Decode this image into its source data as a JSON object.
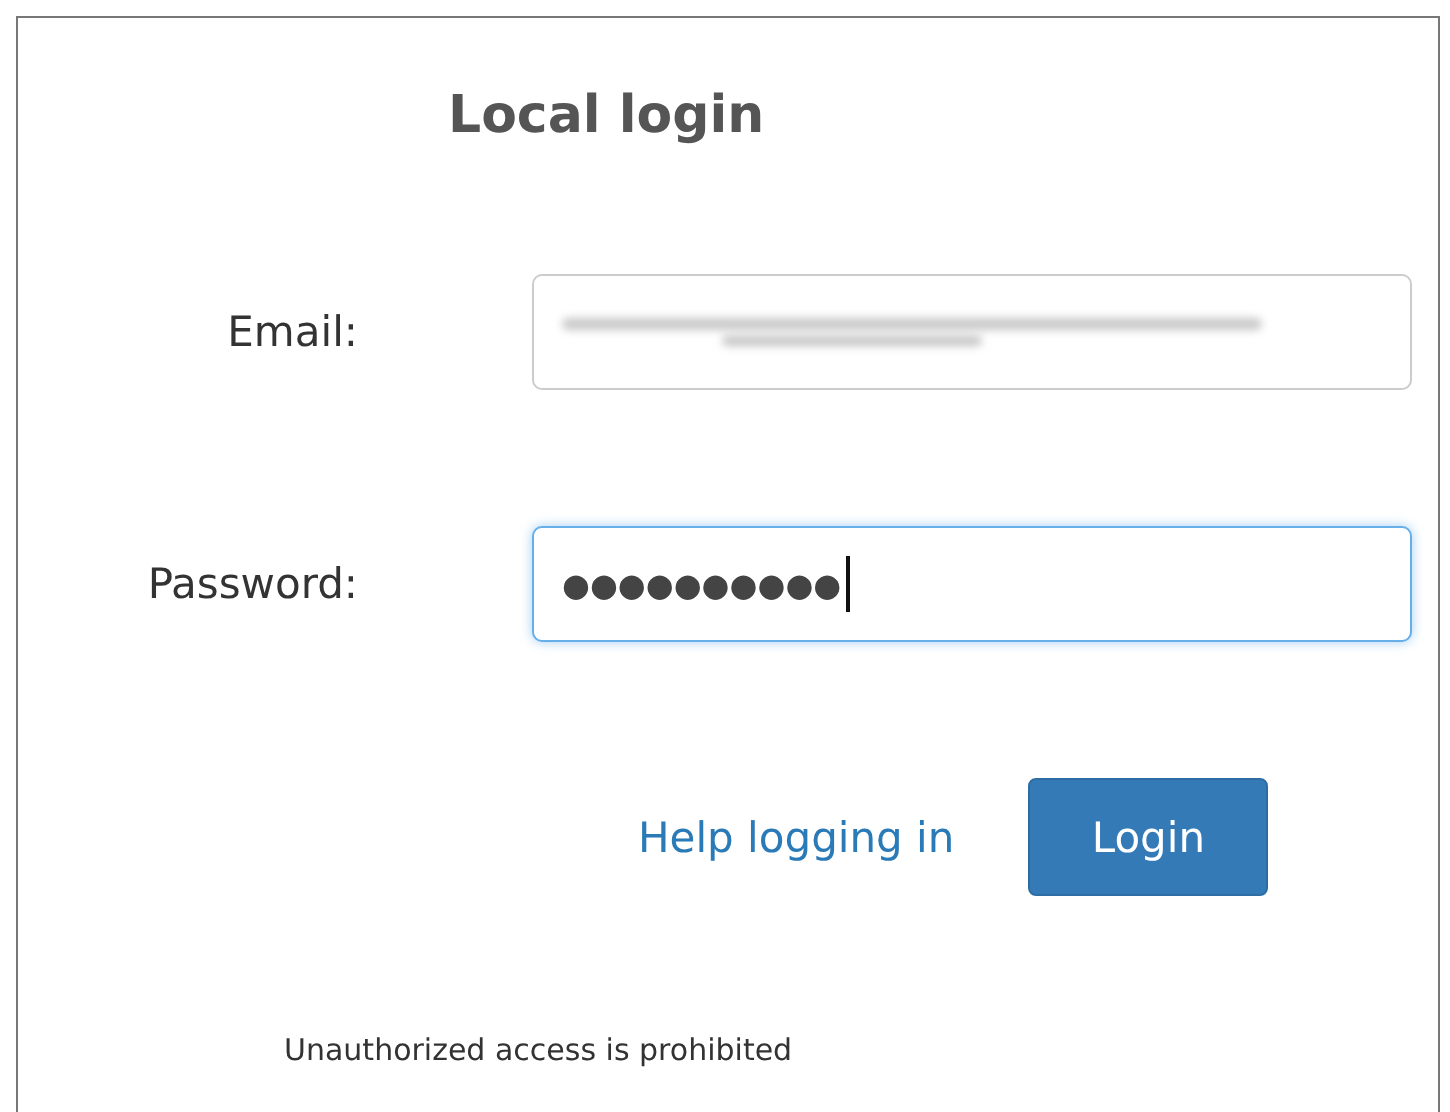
{
  "title": "Local login",
  "fields": [
    {
      "label": "Email:",
      "kind": "blurred",
      "focused": false
    },
    {
      "label": "Password:",
      "kind": "password",
      "value": "●●●●●●●●●●",
      "focused": true
    }
  ],
  "help_link": "Help logging in",
  "login_button": "Login",
  "footer": "Unauthorized access is prohibited"
}
